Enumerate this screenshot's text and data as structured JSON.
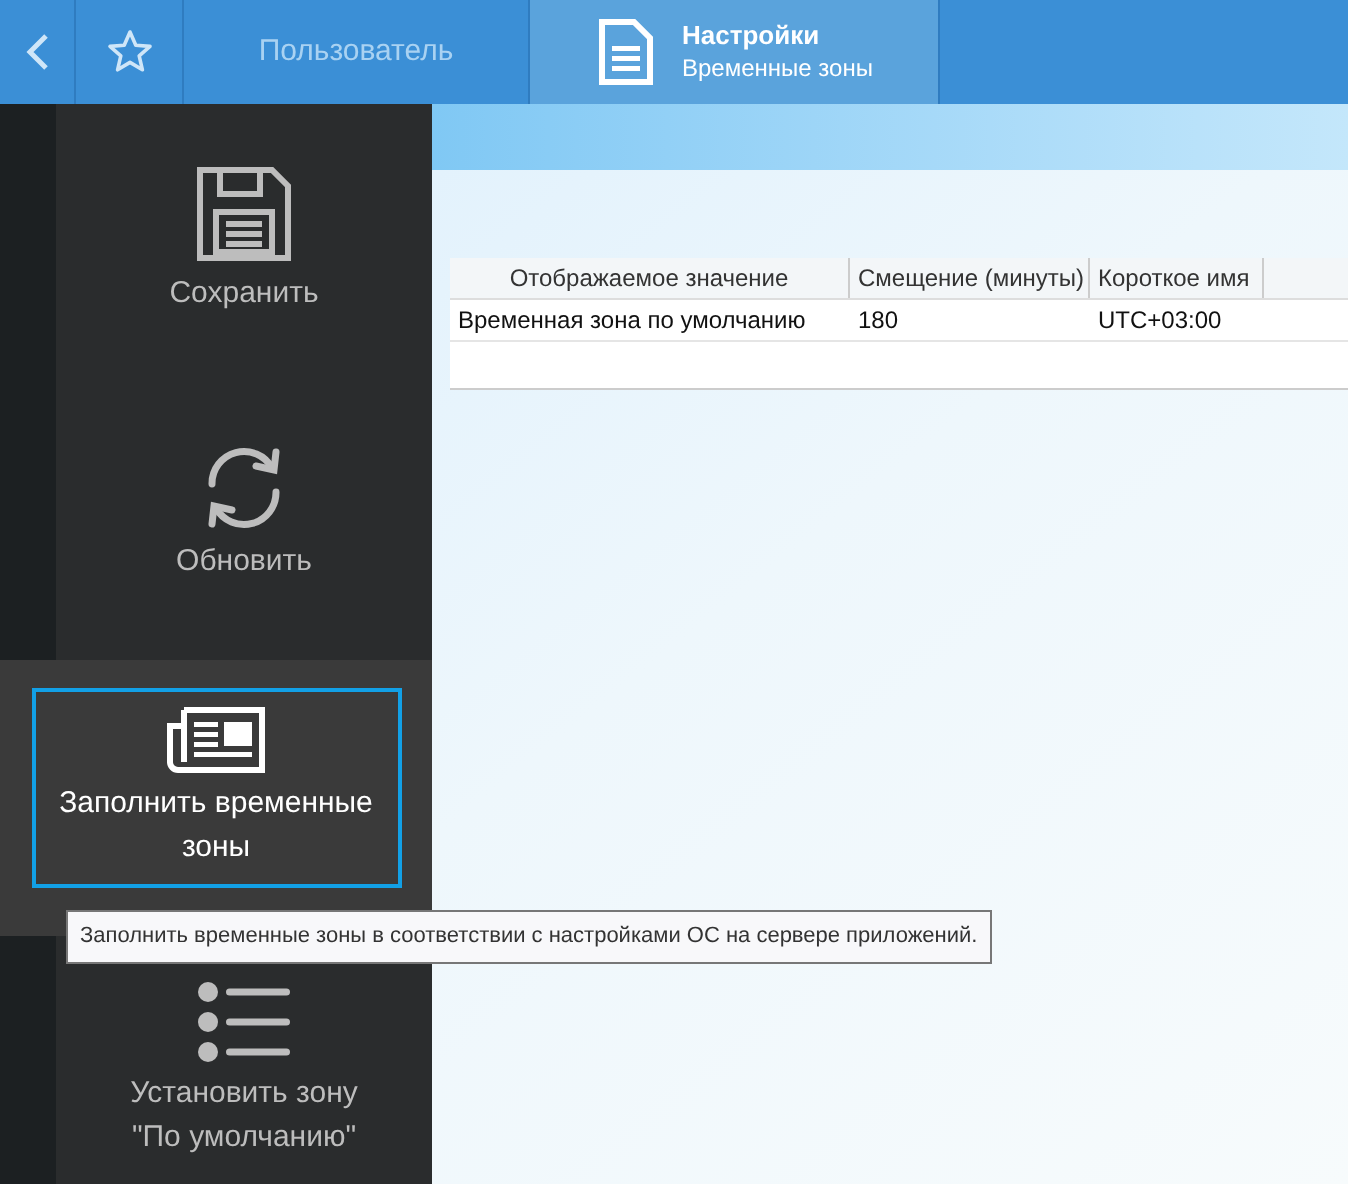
{
  "nav": {
    "tabs": [
      {
        "kind": "back",
        "selected": false
      },
      {
        "kind": "favorite",
        "selected": false
      },
      {
        "kind": "text",
        "label": "Пользователь",
        "selected": false
      },
      {
        "kind": "document",
        "title": "Настройки",
        "subtitle": "Временные зоны",
        "selected": true
      }
    ]
  },
  "content": {
    "table": {
      "columns": [
        "Отображаемое значение",
        "Смещение (минуты)",
        "Короткое имя"
      ],
      "rows": [
        [
          "Временная зона по умолчанию",
          "180",
          "UTC+03:00"
        ]
      ]
    }
  },
  "commands": [
    {
      "kind": "save",
      "label": "Сохранить",
      "selected": false
    },
    {
      "kind": "refresh",
      "label": "Обновить",
      "selected": false
    },
    {
      "kind": "fill",
      "label": "Заполнить временные зоны",
      "selected": true
    },
    {
      "kind": "default",
      "label": "Установить зону \"По умолчанию\"",
      "selected": false
    }
  ],
  "tooltip": "Заполнить временные зоны в соответствии с настройками ОС на сервере приложений."
}
